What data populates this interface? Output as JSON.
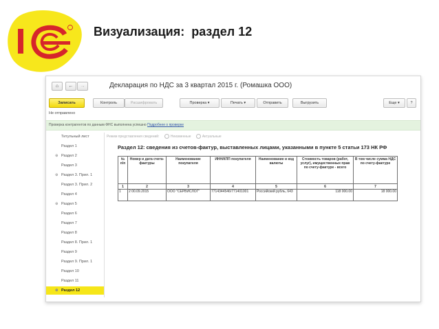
{
  "slide": {
    "title": "Визуализация:  раздел 12"
  },
  "window": {
    "nav": {
      "home": "⌂",
      "back": "←",
      "forward": "→"
    },
    "title": "Декларация по НДС за 3 квартал 2015 г. (Ромашка ООО)"
  },
  "toolbar": {
    "save": "Записать",
    "control": "Контроль",
    "decrypt": "Расшифровать",
    "check": "Проверка",
    "print": "Печать",
    "send": "Отправить",
    "upload": "Выгрузить",
    "more": "Еще",
    "help": "?"
  },
  "status": "Не отправлено",
  "info": {
    "text": "Проверка контрагентов по данным ФНС выполнена успешно",
    "link": "Подробнее о проверке"
  },
  "mode": {
    "label": "Режим представления сведений",
    "option1": "Неизменные",
    "option2": "Актуальные"
  },
  "sidebar": {
    "items": [
      {
        "label": "Титульный лист",
        "expander": ""
      },
      {
        "label": "Раздел 1",
        "expander": ""
      },
      {
        "label": "Раздел 2",
        "expander": "⊕"
      },
      {
        "label": "Раздел 3",
        "expander": ""
      },
      {
        "label": "Раздел 3. Прил. 1",
        "expander": "⊕"
      },
      {
        "label": "Раздел 3. Прил. 2",
        "expander": ""
      },
      {
        "label": "Раздел 4",
        "expander": ""
      },
      {
        "label": "Раздел 5",
        "expander": "⊕"
      },
      {
        "label": "Раздел 6",
        "expander": ""
      },
      {
        "label": "Раздел 7",
        "expander": ""
      },
      {
        "label": "Раздел 8",
        "expander": ""
      },
      {
        "label": "Раздел 8. Прил. 1",
        "expander": ""
      },
      {
        "label": "Раздел 9",
        "expander": ""
      },
      {
        "label": "Раздел 9. Прил. 1",
        "expander": ""
      },
      {
        "label": "Раздел 10",
        "expander": ""
      },
      {
        "label": "Раздел 11",
        "expander": ""
      },
      {
        "label": "Раздел 12",
        "expander": "⊕"
      }
    ]
  },
  "section": {
    "title": "Раздел 12: сведения из счетов-фактур, выставленных лицами, указанными в пункте 5 статьи 173 НК РФ"
  },
  "table": {
    "headers": [
      "№ п/п",
      "Номер и дата счета-фактуры",
      "Наименование покупателя",
      "ИНН/КПП покупателя",
      "Наименование и код валюты",
      "Стоимость товаров (работ, услуг), имущественных прав по счету-фактуре - всего",
      "В том числе сумма НДС по счету-фактуре"
    ],
    "numbers": [
      "1",
      "2",
      "3",
      "4",
      "5",
      "6",
      "7"
    ],
    "row": [
      "1",
      "2 00.09.2015",
      "ООО \"СЕРВИСЛОГ\"",
      "7714344546/771401001",
      "Российский рубль, 643",
      "118 000.00",
      "18 000.00"
    ]
  },
  "colors": {
    "accent_yellow": "#f6e619",
    "logo_red": "#d6252b",
    "info_green": "#e4f3df"
  }
}
